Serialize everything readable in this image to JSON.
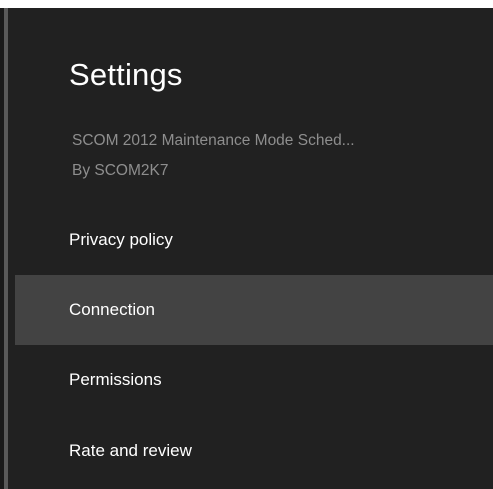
{
  "settings": {
    "title": "Settings",
    "app_name": "SCOM 2012 Maintenance Mode Sched...",
    "app_author": "By SCOM2K7",
    "items": [
      {
        "label": "Privacy policy",
        "selected": false
      },
      {
        "label": "Connection",
        "selected": true
      },
      {
        "label": "Permissions",
        "selected": false
      },
      {
        "label": "Rate and review",
        "selected": false
      }
    ]
  },
  "colors": {
    "panel_background": "#212121",
    "selected_background": "#434343",
    "primary_text": "#ffffff",
    "secondary_text": "#8e8e8e"
  }
}
